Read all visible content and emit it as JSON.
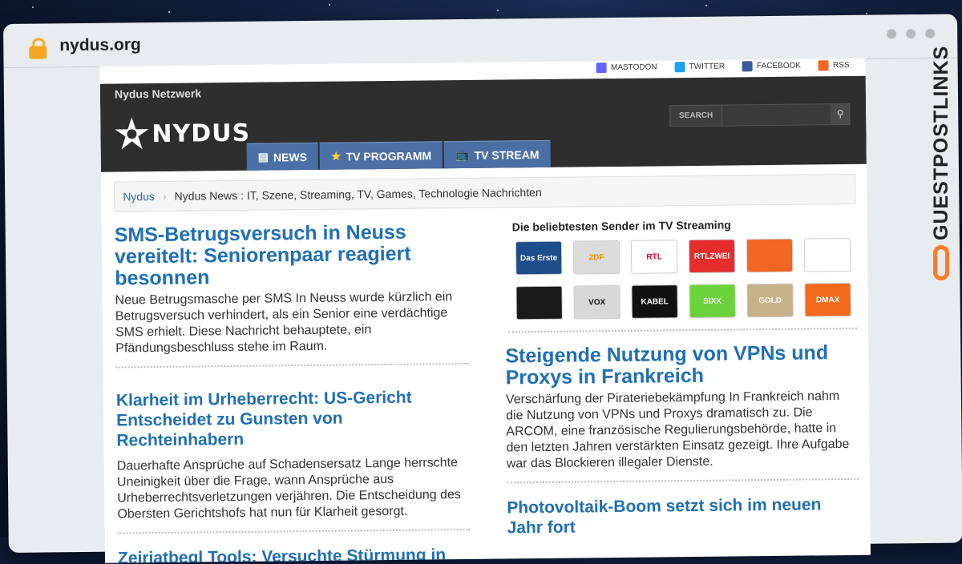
{
  "browser": {
    "url": "nydus.org"
  },
  "social": [
    {
      "label": "MASTODON",
      "icon": "mastodon-icon",
      "color": "#6364ff"
    },
    {
      "label": "TWITTER",
      "icon": "twitter-icon",
      "color": "#1da1f2"
    },
    {
      "label": "FACEBOOK",
      "icon": "facebook-icon",
      "color": "#3b5998"
    },
    {
      "label": "RSS",
      "icon": "rss-icon",
      "color": "#f26522"
    }
  ],
  "header": {
    "network": "Nydus Netzwerk",
    "logo_text": "NYDUS",
    "search_label": "SEARCH"
  },
  "nav": [
    {
      "label": "NEWS",
      "icon": "newspaper-icon",
      "glyph": "▤"
    },
    {
      "label": "TV PROGRAMM",
      "icon": "star-icon",
      "glyph": "★"
    },
    {
      "label": "TV STREAM",
      "icon": "tv-icon",
      "glyph": "📺"
    }
  ],
  "breadcrumb": {
    "home": "Nydus",
    "current": "Nydus News : IT, Szene, Streaming, TV, Games, Technologie Nachrichten"
  },
  "left_articles": [
    {
      "title": "SMS-Betrugsversuch in Neuss vereitelt: Seniorenpaar reagiert besonnen",
      "text": "Neue Betrugsmasche per SMS In Neuss wurde kürzlich ein Betrugsversuch verhindert, als ein Senior eine verdächtige SMS erhielt. Diese Nachricht behauptete, ein Pfändungsbeschluss stehe im Raum."
    },
    {
      "title": "Klarheit im Urheberrecht: US-Gericht Entscheidet zu Gunsten von Rechteinhabern",
      "text": "Dauerhafte Ansprüche auf Schadensersatz Lange herrschte Uneinigkeit über die Frage, wann Ansprüche aus Urheberrechtsverletzungen verjähren. Die Entscheidung des Obersten Gerichtshofs hat nun für Klarheit gesorgt."
    },
    {
      "title": "Zeiriatbegl Tools: Versuchte Stürmung in",
      "text": ""
    }
  ],
  "sender": {
    "title": "Die beliebtesten Sender im TV Streaming",
    "channels": [
      {
        "label": "Das Erste",
        "bg": "#1e4d8c",
        "fg": "#ffffff"
      },
      {
        "label": "2DF",
        "bg": "#dcdcdc",
        "fg": "#f28b00"
      },
      {
        "label": "RTL",
        "bg": "#ffffff",
        "fg": "#e3002d"
      },
      {
        "label": "RTLZWEI",
        "bg": "#e52d2d",
        "fg": "#ffffff"
      },
      {
        "label": "",
        "bg": "#f26522",
        "fg": "#ffffff"
      },
      {
        "label": "",
        "bg": "#ffffff",
        "fg": "#c21f6a"
      },
      {
        "label": "",
        "bg": "#1a1a1a",
        "fg": "#e3002d"
      },
      {
        "label": "VOX",
        "bg": "#d8d8d8",
        "fg": "#111111"
      },
      {
        "label": "KABEL",
        "bg": "#111111",
        "fg": "#ffffff"
      },
      {
        "label": "SIXX",
        "bg": "#6bd23c",
        "fg": "#ffffff"
      },
      {
        "label": "GOLD",
        "bg": "#c8b088",
        "fg": "#ffffff"
      },
      {
        "label": "DMAX",
        "bg": "#f26a1b",
        "fg": "#ffffff"
      }
    ]
  },
  "right_articles": [
    {
      "title": "Steigende Nutzung von VPNs und Proxys in Frankreich",
      "text": "Verschärfung der Pirateriebekämpfung In Frankreich nahm die Nutzung von VPNs und Proxys dramatisch zu. Die ARCOM, eine französische Regulierungsbehörde, hatte in den letzten Jahren verstärkten Einsatz gezeigt. Ihre Aufgabe war das Blockieren illegaler Dienste."
    },
    {
      "title": "Photovoltaik-Boom setzt sich im neuen Jahr fort",
      "text": ""
    }
  ],
  "watermark": "GUESTPOSTLINKS"
}
